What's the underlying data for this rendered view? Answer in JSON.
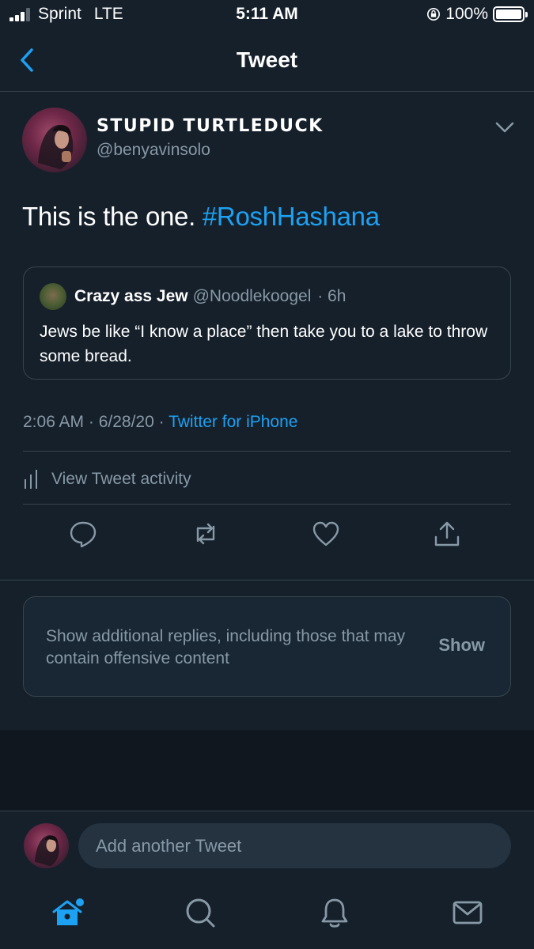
{
  "status_bar": {
    "carrier": "Sprint",
    "network": "LTE",
    "time": "5:11 AM",
    "battery": "100%",
    "battery_level": 1.0
  },
  "header": {
    "title": "Tweet",
    "back_icon": "chevron-left-icon"
  },
  "tweet": {
    "display_name": "STUPID TURTLEDUCK",
    "handle": "@benyavinsolo",
    "text": "This is the one. ",
    "hashtag": "#RoshHashana",
    "quote": {
      "name": "Crazy ass Jew",
      "handle": "@Noodlekoogel",
      "time": "· 6h",
      "text": "Jews be like “I know a place” then take you to a lake to throw some bread."
    },
    "timestamp": "2:06 AM · 6/28/20 · ",
    "source": "Twitter for iPhone",
    "activity_label": "View Tweet activity"
  },
  "actions": [
    "reply-icon",
    "retweet-icon",
    "like-icon",
    "share-icon"
  ],
  "sensitive_replies": {
    "text": "Show additional replies, including those that may contain offensive content",
    "button": "Show"
  },
  "reply": {
    "placeholder": "Add another Tweet"
  },
  "tab_bar": [
    "home-icon",
    "search-icon",
    "notifications-icon",
    "messages-icon"
  ],
  "colors": {
    "background": "#15202b",
    "accent": "#1da1f2",
    "secondary_text": "#8899a6",
    "border": "#38444d"
  }
}
